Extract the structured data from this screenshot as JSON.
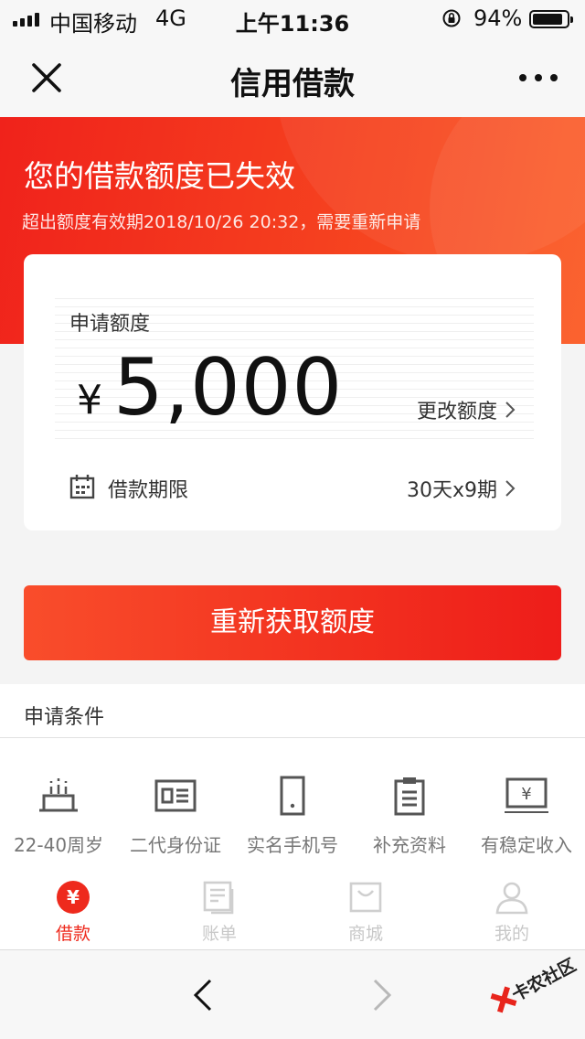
{
  "status_bar": {
    "carrier": "中国移动",
    "network": "4G",
    "time": "上午11:36",
    "battery": "94%",
    "battery_level": 0.94
  },
  "nav": {
    "title": "信用借款",
    "close_icon": "close-icon",
    "more_icon": "more-dots-icon"
  },
  "banner": {
    "title": "您的借款额度已失效",
    "subtitle": "超出额度有效期2018/10/26 20:32，需要重新申请"
  },
  "card": {
    "amount_label": "申请额度",
    "currency": "¥",
    "amount": "5,000",
    "change_limit": "更改额度",
    "term_label": "借款期限",
    "term_value": "30天x9期"
  },
  "primary_button": "重新获取额度",
  "conditions": {
    "title": "申请条件",
    "items": [
      {
        "label": "22-40周岁",
        "icon": "birthday-cake-icon"
      },
      {
        "label": "二代身份证",
        "icon": "id-card-icon"
      },
      {
        "label": "实名手机号",
        "icon": "mobile-phone-icon"
      },
      {
        "label": "补充资料",
        "icon": "clipboard-icon"
      },
      {
        "label": "有稳定收入",
        "icon": "income-icon"
      }
    ]
  },
  "tabs": [
    {
      "label": "借款",
      "icon": "loan-yen-icon",
      "active": true
    },
    {
      "label": "账单",
      "icon": "bill-icon",
      "active": false
    },
    {
      "label": "商城",
      "icon": "shop-bag-icon",
      "active": false
    },
    {
      "label": "我的",
      "icon": "profile-icon",
      "active": false
    }
  ],
  "watermark": "卡农社区",
  "colors": {
    "accent": "#ee2a1d",
    "banner_start": "#f0221b",
    "banner_end": "#fb5a22",
    "inactive_tab": "#c8c8c8"
  }
}
